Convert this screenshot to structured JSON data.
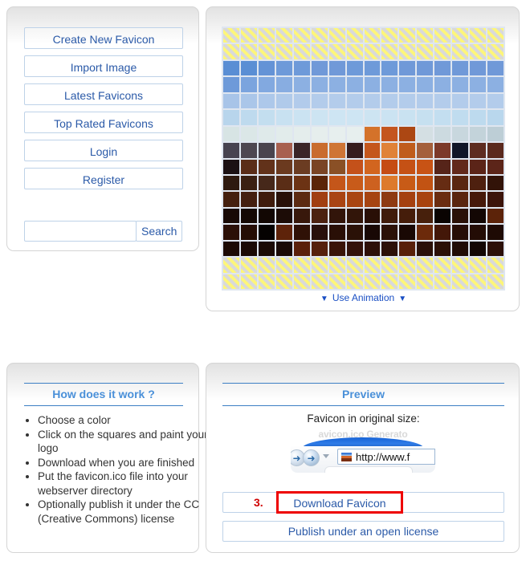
{
  "sidebar": {
    "items": [
      {
        "label": "Create New Favicon",
        "highlight": true
      },
      {
        "label": "Import Image",
        "highlight": false
      },
      {
        "label": "Latest Favicons",
        "highlight": false
      },
      {
        "label": "Top Rated Favicons",
        "highlight": false
      },
      {
        "label": "Login",
        "highlight": false
      },
      {
        "label": "Register",
        "highlight": false
      }
    ],
    "search": {
      "value": "",
      "placeholder": "",
      "button_label": "Search"
    }
  },
  "editor": {
    "animation": {
      "label": "Use Animation",
      "left_caret": "▼",
      "right_caret": "▼"
    },
    "grid": {
      "columns": 16,
      "rows": 16,
      "transparent_token": "T",
      "gridline_color": "#dfe6f0",
      "pixels": [
        [
          "T",
          "T",
          "T",
          "T",
          "T",
          "T",
          "T",
          "T",
          "T",
          "T",
          "T",
          "T",
          "T",
          "T",
          "T",
          "T"
        ],
        [
          "T",
          "T",
          "T",
          "T",
          "T",
          "T",
          "T",
          "T",
          "T",
          "T",
          "T",
          "T",
          "T",
          "T",
          "T",
          "T"
        ],
        [
          "#5a8ed4",
          "#5a8ed4",
          "#6493d6",
          "#6e9ad9",
          "#6e9ad9",
          "#7099d8",
          "#7099d8",
          "#6e9ad9",
          "#6e9ad9",
          "#6e9ad9",
          "#7099d8",
          "#7099d8",
          "#7099d8",
          "#7099d8",
          "#7099d8",
          "#7099d8"
        ],
        [
          "#6e9ad9",
          "#7ba4de",
          "#82a9e0",
          "#88ade1",
          "#8cb0e2",
          "#8cb0e2",
          "#8cb0e2",
          "#8cb0e2",
          "#8cb0e2",
          "#8cb0e2",
          "#8cb0e2",
          "#8cb0e2",
          "#8cb0e2",
          "#8cb0e2",
          "#8cb0e2",
          "#8cb0e2"
        ],
        [
          "#a8c4e8",
          "#aac6e9",
          "#adc8ea",
          "#b0caea",
          "#b2cbeb",
          "#b3cceb",
          "#b3cceb",
          "#b3cceb",
          "#b3cceb",
          "#b3cceb",
          "#b3cceb",
          "#b3cceb",
          "#b3cceb",
          "#b3cceb",
          "#b3cceb",
          "#b3cceb"
        ],
        [
          "#b8d5ec",
          "#bedaee",
          "#c3deef",
          "#c8e1f1",
          "#cbe3f2",
          "#cde4f2",
          "#cee5f3",
          "#cee5f3",
          "#cde4f2",
          "#cbe3f2",
          "#c9e2f1",
          "#c6e0f0",
          "#c3def0",
          "#c0dcef",
          "#bddaee",
          "#b9d7ed"
        ],
        [
          "#d7e4e4",
          "#dbe7e7",
          "#dfeaea",
          "#e2eceb",
          "#e4edec",
          "#e6eeed",
          "#e7efee",
          "#e7efee",
          "#d4722a",
          "#c4551f",
          "#ac4713",
          "#d4dfe3",
          "#ccdae0",
          "#c8d7de",
          "#c3d3da",
          "#bdced6"
        ],
        [
          "#474350",
          "#4e4751",
          "#4a444e",
          "#a86050",
          "#3a2528",
          "#c96c2f",
          "#cf7536",
          "#361c1e",
          "#c4571d",
          "#e08238",
          "#c05c1c",
          "#a45f3c",
          "#7c392a",
          "#101528",
          "#5e2c20",
          "#5b2a1e"
        ],
        [
          "#1b1114",
          "#5a2d18",
          "#62321a",
          "#6b3a1f",
          "#6b3c22",
          "#7a4425",
          "#8a5026",
          "#c4511a",
          "#d2651f",
          "#c54c14",
          "#c55115",
          "#c85315",
          "#562419",
          "#62291b",
          "#5b2418",
          "#5c2519"
        ],
        [
          "#2e1a10",
          "#3a2012",
          "#46281a",
          "#5a2d16",
          "#6c3314",
          "#5a2408",
          "#c4561a",
          "#c85b1a",
          "#cd6120",
          "#dd7a2c",
          "#c85b17",
          "#c25313",
          "#662c13",
          "#5a2711",
          "#4e200f",
          "#321308"
        ],
        [
          "#45200f",
          "#441f10",
          "#3f1c0d",
          "#281008",
          "#5c2a11",
          "#a13f12",
          "#a94414",
          "#a94512",
          "#a64412",
          "#8e3a12",
          "#a54010",
          "#a8430f",
          "#6a2c10",
          "#5a250e",
          "#46190a",
          "#3c140a"
        ],
        [
          "#180905",
          "#140804",
          "#120703",
          "#1c0c06",
          "#38180b",
          "#4c2210",
          "#32150a",
          "#321509",
          "#290f06",
          "#401c0b",
          "#451d0a",
          "#47200c",
          "#0a0402",
          "#2a1107",
          "#130704",
          "#5c2309"
        ],
        [
          "#2a0f07",
          "#240d05",
          "#050201",
          "#5e230a",
          "#2f1106",
          "#28100a",
          "#290f06",
          "#2a1107",
          "#180805",
          "#2b1107",
          "#190804",
          "#6c2a0b",
          "#431708",
          "#270e06",
          "#230c05",
          "#1e0a04"
        ],
        [
          "#1c0a05",
          "#1a0905",
          "#1b0a05",
          "#190905",
          "#5a200a",
          "#55200c",
          "#3a1408",
          "#33120a",
          "#2d1008",
          "#2c1007",
          "#58200a",
          "#2a1008",
          "#2b1007",
          "#200b05",
          "#120604",
          "#2c1008"
        ],
        [
          "T",
          "T",
          "T",
          "T",
          "T",
          "T",
          "T",
          "T",
          "T",
          "T",
          "T",
          "T",
          "T",
          "T",
          "T",
          "T"
        ],
        [
          "T",
          "T",
          "T",
          "T",
          "T",
          "T",
          "T",
          "T",
          "T",
          "T",
          "T",
          "T",
          "T",
          "T",
          "T",
          "T"
        ]
      ]
    }
  },
  "howitworks": {
    "title": "How does it work ?",
    "steps": [
      "Choose a color",
      "Click on the squares and paint your logo",
      "Download when you are finished",
      "Put the favicon.ico file into your webserver directory",
      "Optionally publish it under the CC (Creative Commons) license"
    ]
  },
  "preview": {
    "title": "Preview",
    "caption": "Favicon in original size:",
    "browser_mock": {
      "titlebar_text": "avicon.ico Generato",
      "url_text": "http://www.f"
    },
    "step_number": "3.",
    "download_label": "Download Favicon",
    "publish_label": "Publish under an open license",
    "highlight_color": "#ee0000"
  }
}
